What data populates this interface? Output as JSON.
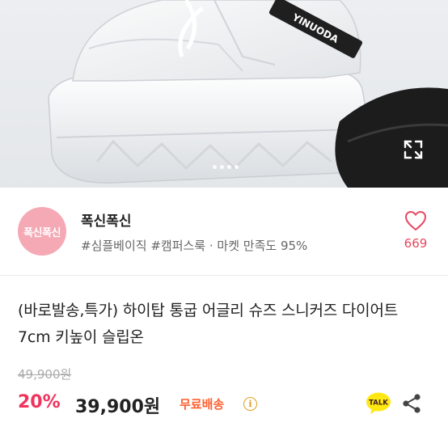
{
  "hero": {
    "brand_strap_text": "YINUODA",
    "expand_icon": "expand-icon",
    "image_dots": 4
  },
  "shop": {
    "avatar_text": "폭신폭신",
    "name": "폭신폭신",
    "tags": "#심플베이직 #캠퍼스룩 · 마켓 만족도 95%",
    "like_count": "669",
    "like_icon": "heart-outline-icon"
  },
  "product": {
    "title": "(바로발송,특가) 하이탑 통굽 어글리 슈즈 스니커즈 다이어트 7cm 키높이 슬립온",
    "original_price": "49,900원",
    "discount": "20%",
    "price": "39,900원",
    "shipping": "무료배송",
    "talk_label": "TALK"
  },
  "colors": {
    "accent_pink": "#f0325c",
    "heart": "#e8485f",
    "shipping_orange": "#ff5f2e",
    "avatar_bg": "#f5a9b5",
    "talk_yellow": "#ffe812"
  }
}
